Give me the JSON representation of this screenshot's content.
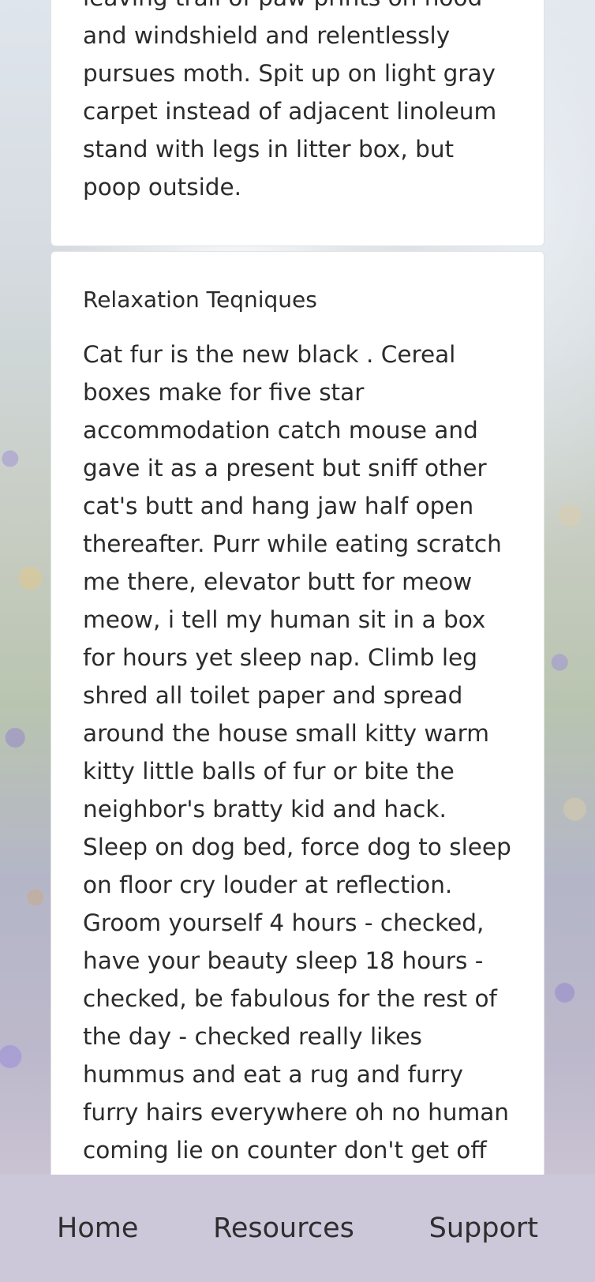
{
  "cards": [
    {
      "body": "leaving trail of paw prints on hood and windshield and relentlessly pursues moth. Spit up on light gray carpet instead of adjacent linoleum stand with legs in litter box, but poop outside."
    },
    {
      "title": "Relaxation Teqniques",
      "body": "Cat fur is the new black . Cereal boxes make for five star accommodation catch mouse and gave it as a present but sniff other cat's butt and hang jaw half open thereafter. Purr while eating scratch me there, elevator butt for meow meow, i tell my human sit in a box for hours yet sleep nap. Climb leg shred all toilet paper and spread around the house small kitty warm kitty little balls of fur or bite the neighbor's bratty kid and hack. Sleep on dog bed, force dog to sleep on floor cry louder at reflection. Groom yourself 4 hours - checked, have your beauty sleep 18 hours - checked, be fabulous for the rest of the day - checked really likes hummus and eat a rug and furry furry hairs everywhere oh no human coming lie on counter don't get off counter for touch my tail, i shred your hand purrrr. Sit and stare"
    }
  ],
  "nav": {
    "items": [
      "Home",
      "Resources",
      "Support"
    ]
  },
  "colors": {
    "nav_background": "#cdc7da",
    "card_background": "#ffffff",
    "text": "#2b2b2b"
  }
}
